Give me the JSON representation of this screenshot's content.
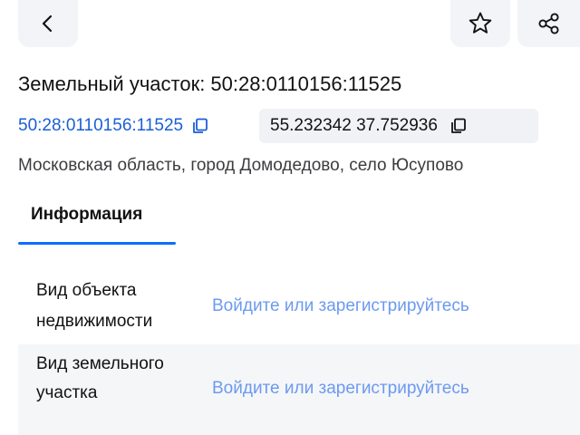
{
  "header": {
    "back_icon": "chevron-left-icon",
    "favorite_icon": "star-icon",
    "share_icon": "share-icon"
  },
  "title": "Земельный участок: 50:28:0110156:11525",
  "cadastral_number": "50:28:0110156:11525",
  "coordinates": "55.232342 37.752936",
  "address": "Московская область, город Домодедово, село Юсупово",
  "tabs": [
    {
      "label": "Информация",
      "active": true
    }
  ],
  "info_rows": [
    {
      "label": "Вид объекта недвижимости",
      "value": "Войдите или зарегистрируйтесь"
    },
    {
      "label": "Вид земельного участка",
      "value": "Войдите или зарегистрируйтесь"
    }
  ],
  "colors": {
    "link": "#1a5fd6",
    "login_link": "#6c9af0",
    "tab_underline": "#0c6dfd",
    "chip_bg": "#f1f2f5"
  }
}
